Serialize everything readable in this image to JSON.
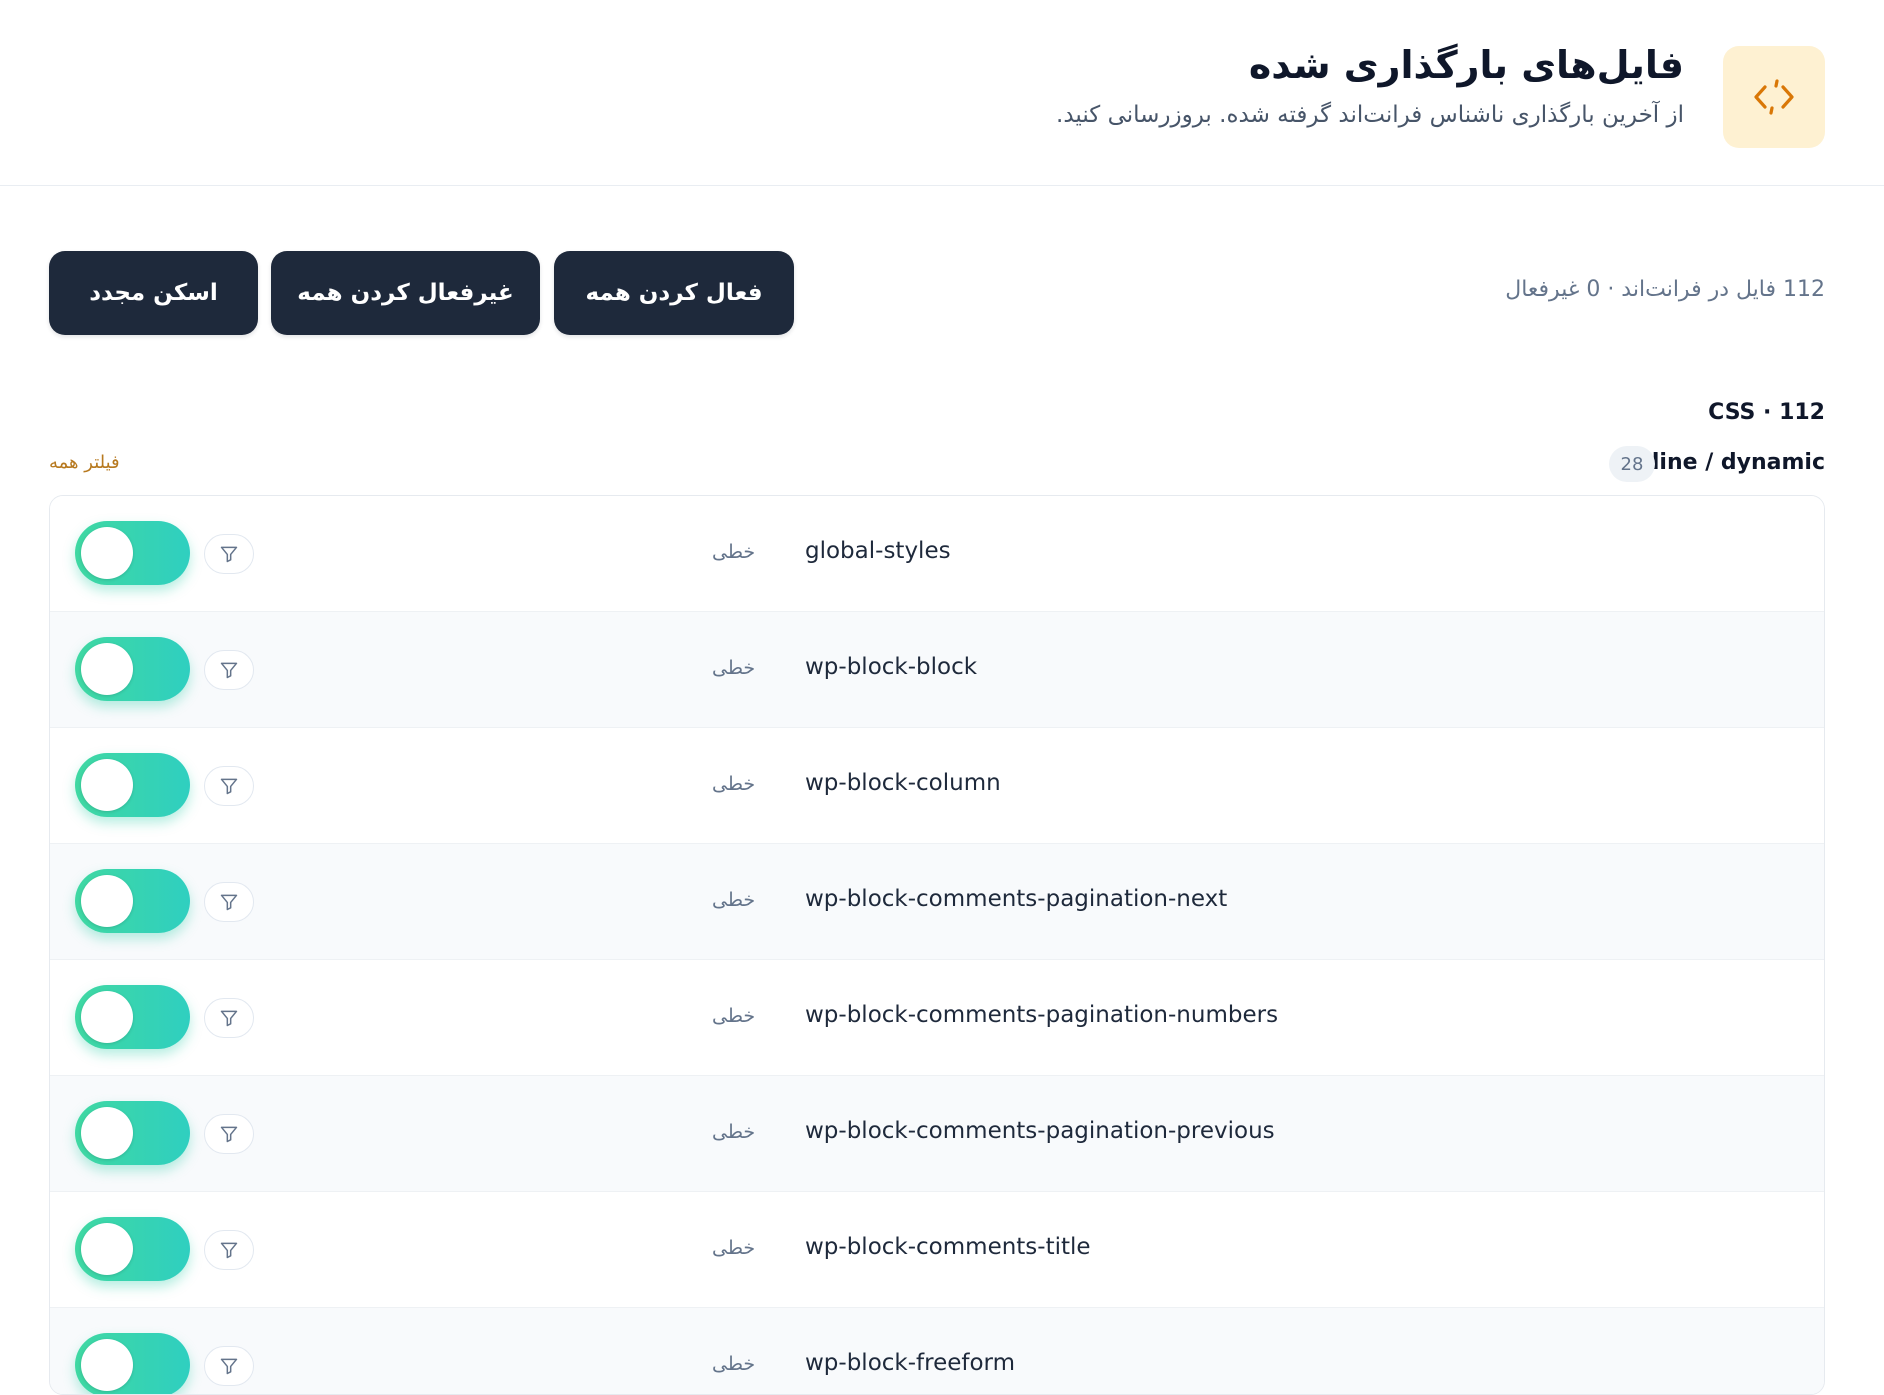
{
  "header": {
    "title": "فایل‌های بارگذاری شده",
    "subtitle": "از آخرین بارگذاری ناشناس فرانت‌اند گرفته شده. بروزرسانی کنید.",
    "icon": "code-icon"
  },
  "toolbar": {
    "summary": "112 فایل در فرانت‌اند · 0 غیرفعال",
    "enable_all_label": "فعال کردن همه",
    "disable_all_label": "غیرفعال کردن همه",
    "rescan_label": "اسکن مجدد"
  },
  "section": {
    "heading": "CSS · 112",
    "group_title": "Inline / dynamic",
    "group_count": "28",
    "filter_all_label": "فیلتر همه"
  },
  "rows": [
    {
      "name": "global-styles",
      "mode": "خطی",
      "enabled": true
    },
    {
      "name": "wp-block-block",
      "mode": "خطی",
      "enabled": true
    },
    {
      "name": "wp-block-column",
      "mode": "خطی",
      "enabled": true
    },
    {
      "name": "wp-block-comments-pagination-next",
      "mode": "خطی",
      "enabled": true
    },
    {
      "name": "wp-block-comments-pagination-numbers",
      "mode": "خطی",
      "enabled": true
    },
    {
      "name": "wp-block-comments-pagination-previous",
      "mode": "خطی",
      "enabled": true
    },
    {
      "name": "wp-block-comments-title",
      "mode": "خطی",
      "enabled": true
    },
    {
      "name": "wp-block-freeform",
      "mode": "خطی",
      "enabled": true
    }
  ],
  "colors": {
    "primary_button": "#1e293b",
    "toggle_on": "#34d3b0",
    "accent_link": "#b7791f",
    "icon_bg": "#fef1d2",
    "icon_stroke": "#d97706"
  }
}
